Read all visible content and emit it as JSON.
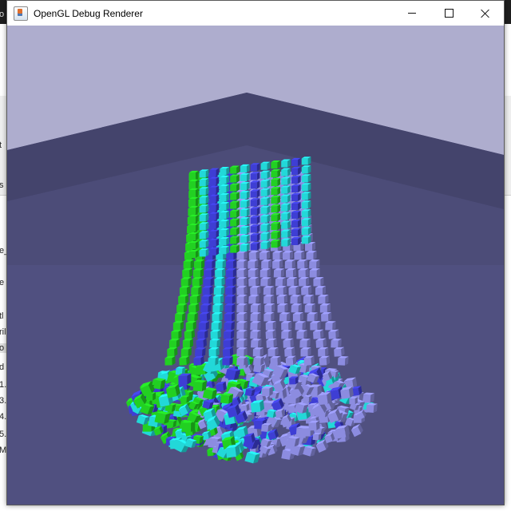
{
  "window": {
    "title": "OpenGL Debug Renderer",
    "controls": [
      "minimize",
      "maximize",
      "close"
    ]
  },
  "background_app": {
    "fragments": [
      "o",
      "t",
      "s",
      "e_",
      "e",
      "tl",
      "ril",
      "o",
      "d",
      "1.",
      "3.",
      "4.",
      "5.",
      "M"
    ]
  },
  "scene": {
    "description_colors": {
      "sky": "#aeadce",
      "back_wall": "#46466c",
      "floor": "#5a5a8c",
      "green": "#22d022",
      "cyan": "#22d8d8",
      "blue": "#3e3ed4",
      "lavender": "#8c8ce0"
    }
  }
}
